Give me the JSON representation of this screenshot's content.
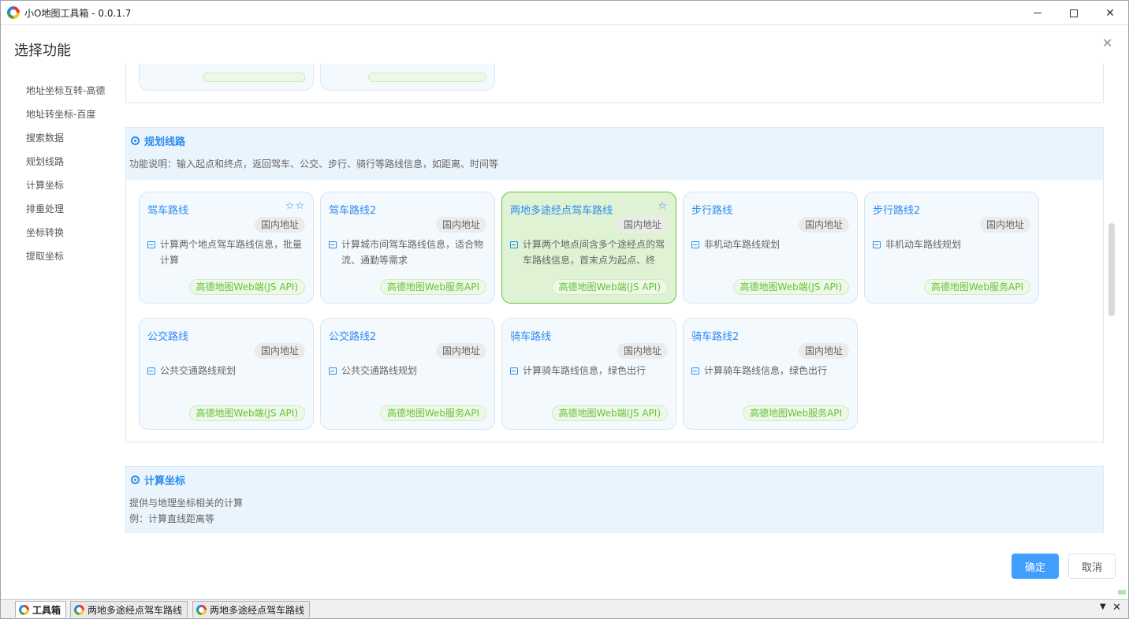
{
  "window": {
    "title": "小O地图工具箱 - 0.0.1.7"
  },
  "dialog": {
    "title": "选择功能",
    "ok_label": "确定",
    "cancel_label": "取消"
  },
  "sidebar": {
    "items": [
      {
        "label": "地址坐标互转-高德"
      },
      {
        "label": "地址转坐标-百度"
      },
      {
        "label": "搜索数据"
      },
      {
        "label": "规划线路"
      },
      {
        "label": "计算坐标"
      },
      {
        "label": "排重处理"
      },
      {
        "label": "坐标转换"
      },
      {
        "label": "提取坐标"
      }
    ]
  },
  "sections": {
    "route": {
      "title": "规划线路",
      "desc": "功能说明：输入起点和终点，返回驾车、公交、步行、骑行等路线信息，如距离、时间等",
      "cards": [
        {
          "title": "驾车路线",
          "stars": "☆☆",
          "region": "国内地址",
          "desc": "计算两个地点驾车路线信息，批量计算",
          "api": "高德地图Web端(JS API)"
        },
        {
          "title": "驾车路线2",
          "stars": "",
          "region": "国内地址",
          "desc": "计算城市间驾车路线信息，适合物流、通勤等需求",
          "api": "高德地图Web服务API"
        },
        {
          "title": "两地多途经点驾车路线",
          "stars": "☆",
          "region": "国内地址",
          "desc": "计算两个地点间含多个途经点的驾车路线信息，首末点为起点、终点...",
          "api": "高德地图Web端(JS API)"
        },
        {
          "title": "步行路线",
          "stars": "",
          "region": "国内地址",
          "desc": "非机动车路线规划",
          "api": "高德地图Web端(JS API)"
        },
        {
          "title": "步行路线2",
          "stars": "",
          "region": "国内地址",
          "desc": "非机动车路线规划",
          "api": "高德地图Web服务API"
        },
        {
          "title": "公交路线",
          "stars": "",
          "region": "国内地址",
          "desc": "公共交通路线规划",
          "api": "高德地图Web端(JS API)"
        },
        {
          "title": "公交路线2",
          "stars": "",
          "region": "国内地址",
          "desc": "公共交通路线规划",
          "api": "高德地图Web服务API"
        },
        {
          "title": "骑车路线",
          "stars": "",
          "region": "国内地址",
          "desc": "计算骑车路线信息，绿色出行",
          "api": "高德地图Web端(JS API)"
        },
        {
          "title": "骑车路线2",
          "stars": "",
          "region": "国内地址",
          "desc": "计算骑车路线信息，绿色出行",
          "api": "高德地图Web服务API"
        }
      ]
    },
    "calc": {
      "title": "计算坐标",
      "desc_line1": "提供与地理坐标相关的计算",
      "desc_line2": "例：计算直线距离等"
    }
  },
  "tabs": [
    {
      "label": "工具箱"
    },
    {
      "label": "两地多途经点驾车路线"
    },
    {
      "label": "两地多途经点驾车路线"
    }
  ],
  "colors": {
    "accent": "#2d8cf0",
    "api_green": "#67c23a",
    "selected_bg": "#dff2d3",
    "ok_button": "#409eff"
  },
  "selected_card_index": 2
}
